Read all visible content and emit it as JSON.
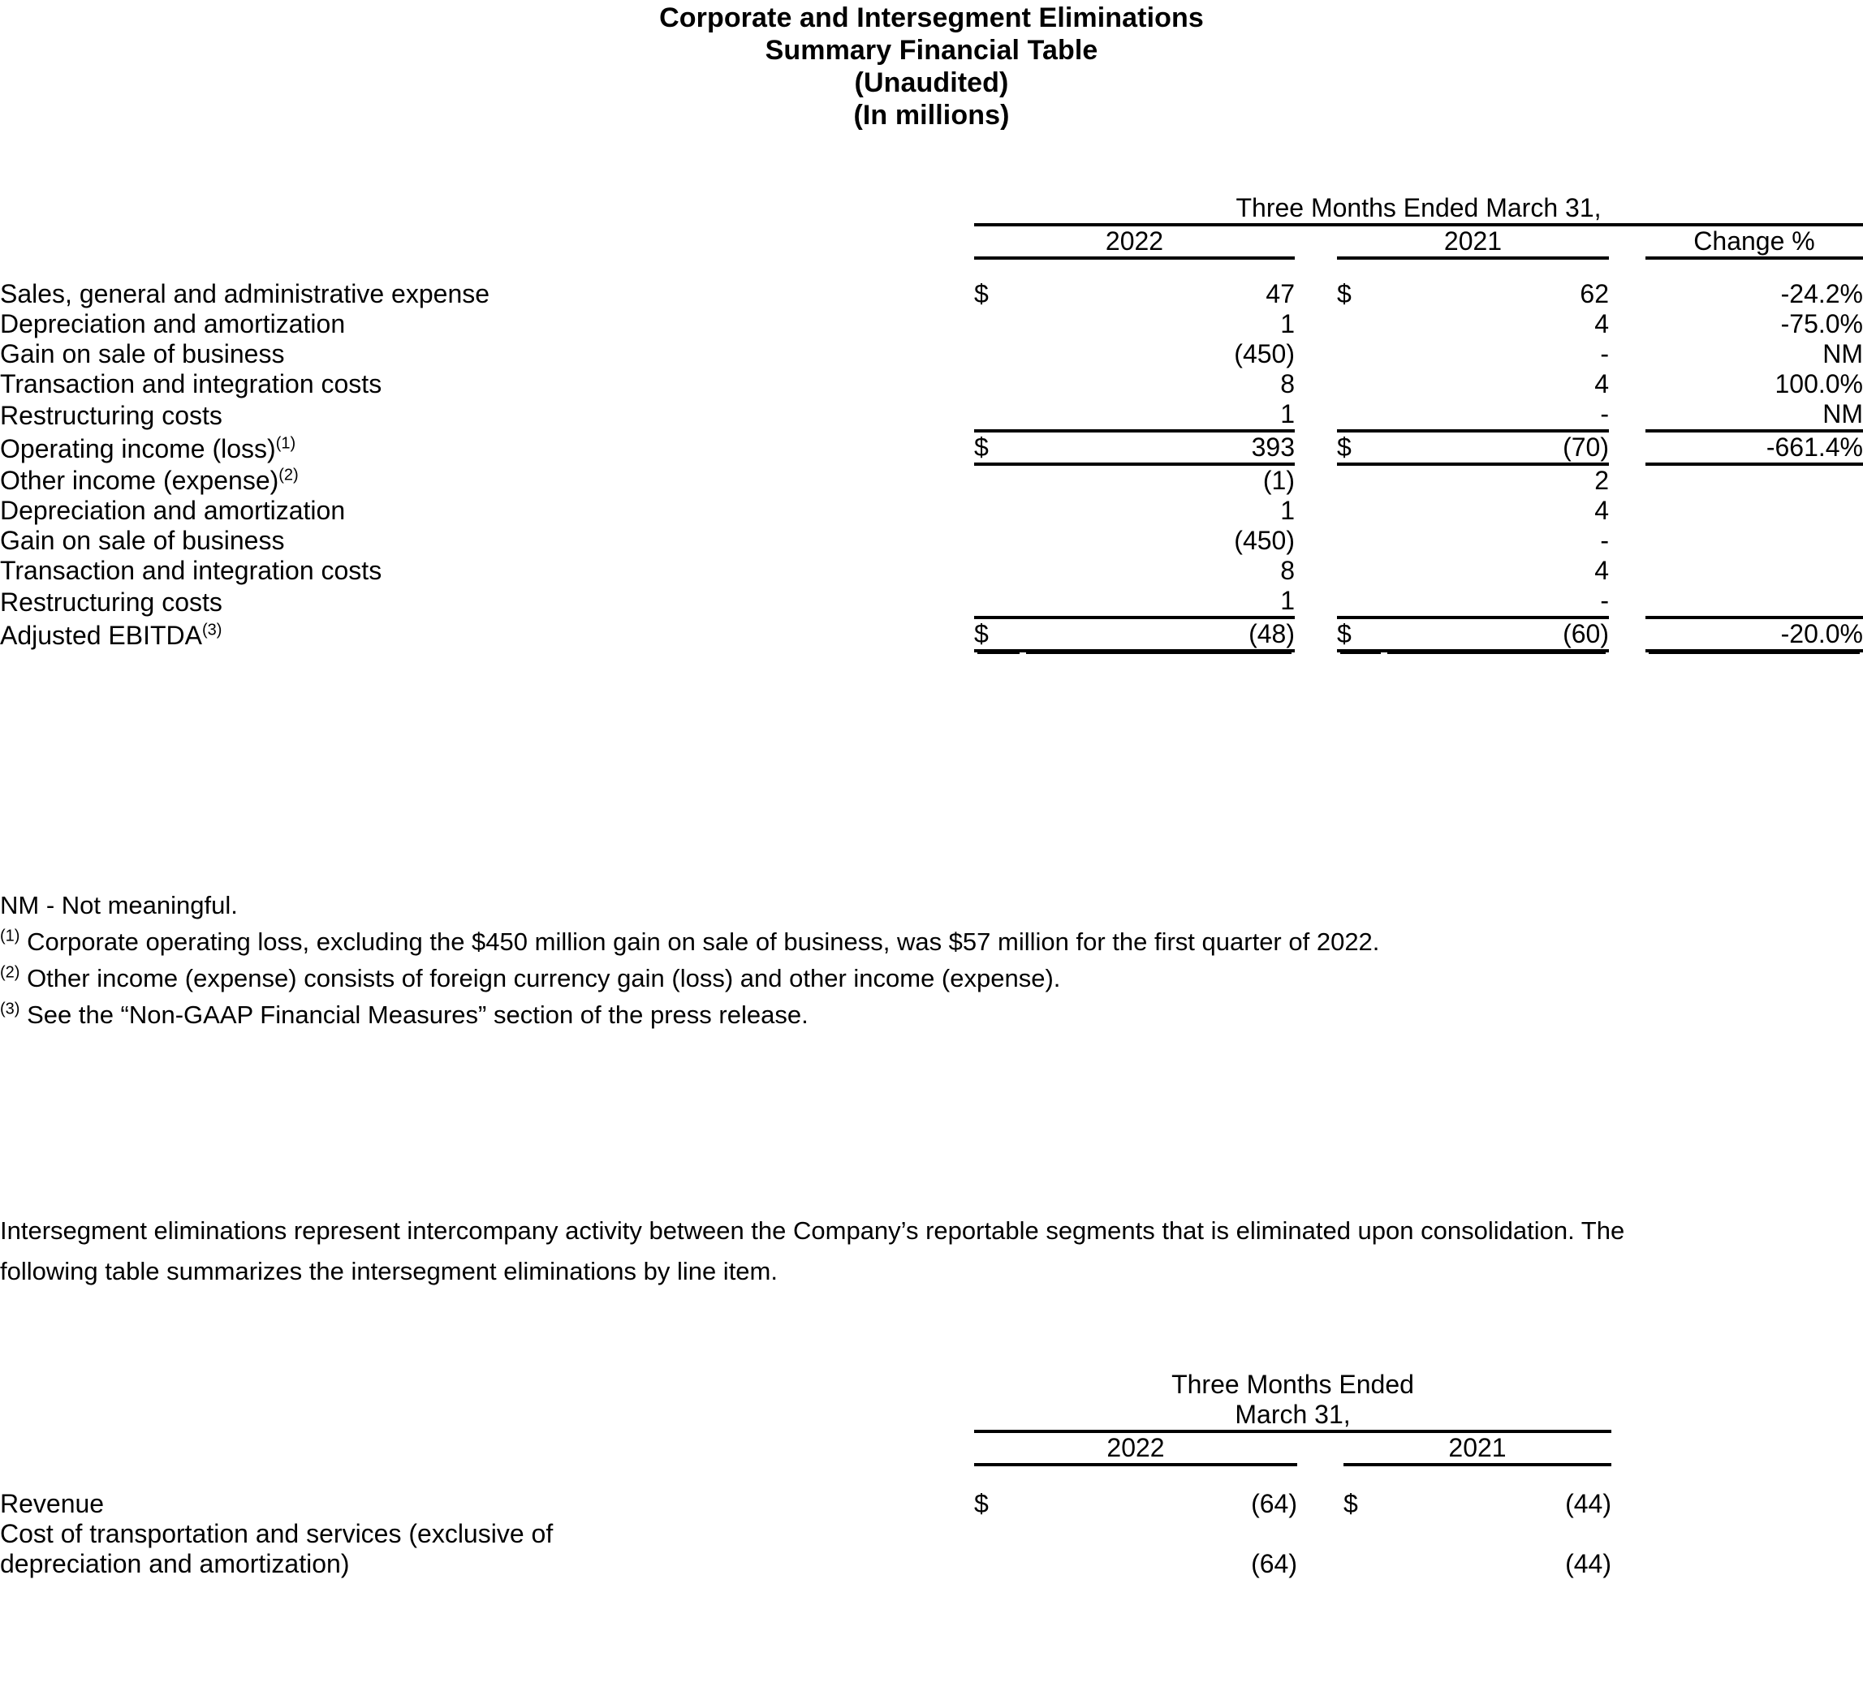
{
  "document": {
    "title_lines": [
      "Corporate and Intersegment Eliminations",
      "Summary Financial Table",
      "(Unaudited)",
      "(In millions)"
    ]
  },
  "table1": {
    "header": {
      "span_label": "Three Months Ended March 31,",
      "year_2022": "2022",
      "year_2021": "2021",
      "change": "Change %"
    },
    "rows": [
      {
        "label": "Sales, general and administrative expense",
        "currency_2022": "$",
        "value_2022": "47",
        "currency_2021": "$",
        "value_2021": "62",
        "change": "-24.2%"
      },
      {
        "label": "Depreciation and amortization",
        "currency_2022": "",
        "value_2022": "1",
        "currency_2021": "",
        "value_2021": "4",
        "change": "-75.0%"
      },
      {
        "label": "Gain on sale of business",
        "currency_2022": "",
        "value_2022": "(450)",
        "currency_2021": "",
        "value_2021": "-",
        "change": "NM"
      },
      {
        "label": "Transaction and integration costs",
        "currency_2022": "",
        "value_2022": "8",
        "currency_2021": "",
        "value_2021": "4",
        "change": "100.0%"
      },
      {
        "label": "Restructuring costs",
        "currency_2022": "",
        "value_2022": "1",
        "currency_2021": "",
        "value_2021": "-",
        "change": "NM"
      }
    ],
    "subtotal": {
      "label": "Operating income (loss)",
      "footnote_marker": "(1)",
      "currency_2022": "$",
      "value_2022": "393",
      "currency_2021": "$",
      "value_2021": "(70)",
      "change": "-661.4%"
    },
    "rows2": [
      {
        "label": "Other income (expense)",
        "footnote_marker": "(2)",
        "value_2022": "(1)",
        "value_2021": "2",
        "change": ""
      },
      {
        "label": "Depreciation and amortization",
        "footnote_marker": "",
        "value_2022": "1",
        "value_2021": "4",
        "change": ""
      },
      {
        "label": "Gain on sale of business",
        "footnote_marker": "",
        "value_2022": "(450)",
        "value_2021": "-",
        "change": ""
      },
      {
        "label": "Transaction and integration costs",
        "footnote_marker": "",
        "value_2022": "8",
        "value_2021": "4",
        "change": ""
      },
      {
        "label": "Restructuring costs",
        "footnote_marker": "",
        "value_2022": "1",
        "value_2021": "-",
        "change": ""
      }
    ],
    "total": {
      "label": "Adjusted EBITDA",
      "footnote_marker": "(3)",
      "currency_2022": "$",
      "value_2022": "(48)",
      "currency_2021": "$",
      "value_2021": "(60)",
      "change": "-20.0%"
    }
  },
  "footnotes": {
    "nm": "NM - Not meaningful.",
    "n1_marker": "(1)",
    "n1_text": " Corporate operating loss, excluding the $450 million gain on sale of business, was $57 million for the first quarter of 2022.",
    "n2_marker": "(2)",
    "n2_text": " Other income (expense) consists of foreign currency gain (loss) and other income (expense).",
    "n3_marker": "(3)",
    "n3_text": " See the “Non-GAAP Financial Measures” section of the press release."
  },
  "paragraph": {
    "text": "Intersegment eliminations represent intercompany activity between the Company’s reportable segments that is eliminated upon consolidation. The following table summarizes the intersegment eliminations by line item."
  },
  "table2": {
    "header": {
      "span_line1": "Three Months Ended",
      "span_line2": "March 31,",
      "year_2022": "2022",
      "year_2021": "2021"
    },
    "rows": [
      {
        "label": "Revenue",
        "label_line2": "",
        "currency_2022": "$",
        "value_2022": "(64)",
        "currency_2021": "$",
        "value_2021": "(44)"
      },
      {
        "label": "Cost of transportation and services (exclusive of",
        "label_line2": "depreciation and amortization)",
        "currency_2022": "",
        "value_2022": "(64)",
        "currency_2021": "",
        "value_2021": "(44)"
      }
    ]
  }
}
